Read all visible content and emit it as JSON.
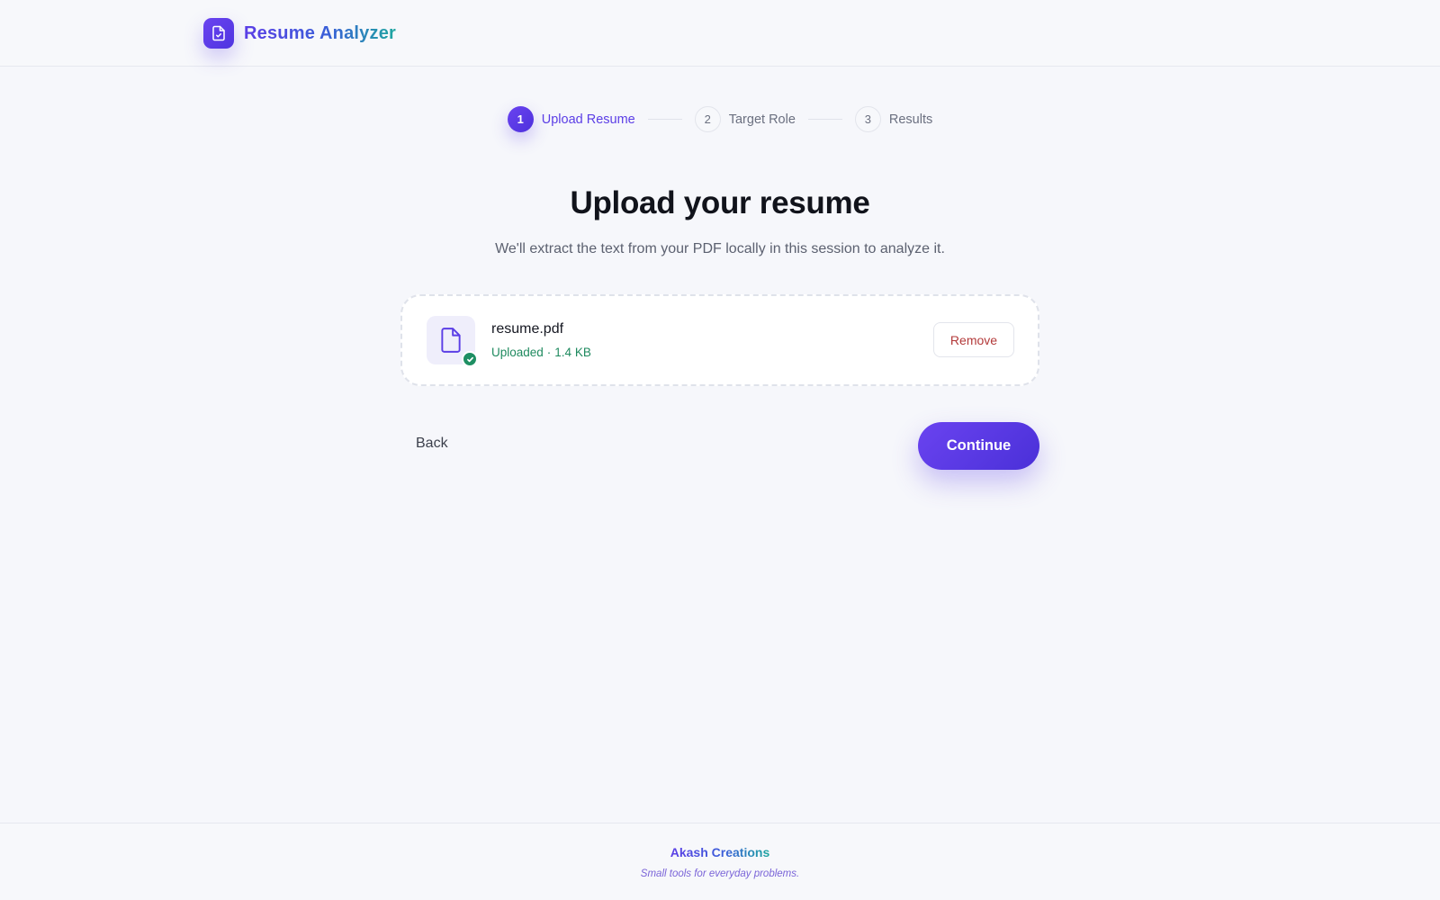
{
  "header": {
    "app_name": "Resume Analyzer",
    "logo_icon": "document-check-icon"
  },
  "stepper": {
    "steps": [
      {
        "number": "1",
        "label": "Upload Resume",
        "state": "active"
      },
      {
        "number": "2",
        "label": "Target Role",
        "state": "inactive"
      },
      {
        "number": "3",
        "label": "Results",
        "state": "inactive"
      }
    ]
  },
  "main": {
    "title": "Upload your resume",
    "subtitle": "We'll extract the text from your PDF locally in this session to analyze it.",
    "file": {
      "icon": "file-icon",
      "badge_icon": "check-icon",
      "name": "resume.pdf",
      "status": "Uploaded",
      "separator": "·",
      "size": "1.4 KB"
    },
    "remove_label": "Remove",
    "back_label": "Back",
    "continue_label": "Continue"
  },
  "footer": {
    "name": "Akash Creations",
    "tagline": "Small tools for everyday problems."
  },
  "colors": {
    "accent": "#5b3ee6",
    "success": "#1f8a5f",
    "danger": "#b33a3a",
    "background": "#f6f7fb"
  }
}
